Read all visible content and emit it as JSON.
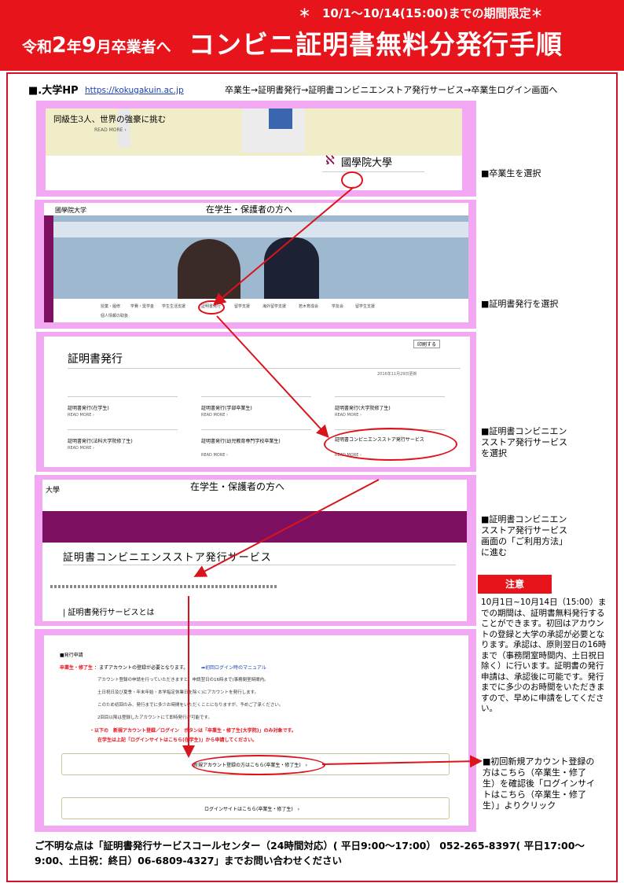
{
  "banner": {
    "subtitle": "＊　10/1～10/14(15:00)までの期間限定＊",
    "lead_a": "令和",
    "lead_b": "2",
    "lead_c": "年",
    "lead_d": "9",
    "lead_e": "月卒業者へ",
    "title": "コンビニ証明書無料分発行手順"
  },
  "header": {
    "hp_label": "■.大学HP",
    "url": "https://kokugakuin.ac.jp",
    "nav_path": "卒業生→証明書発行→証明書コンビニエンストア発行サービス→卒業生ログイン画面へ"
  },
  "steps": {
    "s1": {
      "banner_text": "同級生3人、世界の強豪に挑む",
      "read_more": "READ  MORE  ›",
      "university": "國學院大學",
      "note": "■卒業生を選択"
    },
    "s2": {
      "logo": "國學院大学",
      "heading": "在学生・保護者の方へ",
      "note": "■証明書発行を選択",
      "menu": [
        "授業・履修",
        "学費・奨学金",
        "学生生活支援",
        "証明書発行",
        "留学支援",
        "海外留学支援",
        "若木育成会",
        "学友会",
        "留学生支援",
        "個人情報の取扱"
      ]
    },
    "s3": {
      "print": "印刷する",
      "heading": "証明書発行",
      "date": "2016年11月29日更新",
      "read_more": "READ  MORE  ›",
      "items": [
        "証明書発行(在学生)",
        "証明書発行(学部卒業生)",
        "証明書発行(大学院修了生)",
        "証明書発行(法科大学院修了生)",
        "証明書発行(幼児教育専門学校卒業生)",
        "証明書コンビニエンスストア発行サービス"
      ],
      "note": "■証明書コンビニエン\nスストア発行サービス\nを選択"
    },
    "s4": {
      "logo": "大學",
      "heading": "在学生・保護者の方へ",
      "service_title": "証明書コンビニエンスストア発行サービス",
      "section": "| 証明書発行サービスとは",
      "note": "■証明書コンビニエン\nスストア発行サービス\n画面の「ご利用方法」\nに進む"
    },
    "s5": {
      "label": "■発行申請",
      "role": "卒業生・修了生",
      "intro": "：まずアカウントの登録が必要となります。",
      "manual_link": "➡初回ログイン時のマニュアル",
      "lines": [
        "アカウント登録の申請を行っていただきますと、申請翌日の16時まで(事務閉室時間内。",
        "土日祝日及び夏季・年末年始・本学指定休業日を除く)にアカウントを発行します。",
        "このため初回のみ、発行までに多少お時間をいただくことになりますが、予めご了承ください。",
        "2回目以降は登録したアカウントにて即時発行が可能です。"
      ],
      "red1": "・以下の　新規アカウント登録／ログイン　ボタンは「卒業生・修了生(大学院)」のみ対象です。",
      "red2": "在学生は上記「ログインサイトはこちら(在学生)」から申請してください。",
      "btn_new": "新規アカウント登録の方はこちら(卒業生・修了生)　›",
      "btn_login": "ログインサイトはこちら(卒業生・修了生)　›",
      "note": "■初回新規アカウント登録の\n方はこちら（卒業生・修了\n生）を確認後「ログインサイ\nトはこちら（卒業生・修了\n生）」よりクリック"
    }
  },
  "caution": {
    "label": "注意",
    "text": "10月1日~10月14日（15:00）までの期間は、証明書無料発行することができます。初回はアカウントの登録と大学の承認が必要となります。承認は、原則翌日の16時まで（事務閉室時間内、土日祝日除く）に行います。証明書の発行申請は、承認後に可能です。発行までに多少のお時間をいただきますので、早めに申請をしてください。"
  },
  "footer": {
    "text": "ご不明な点は「証明書発行サービスコールセンター（24時間対応）( 平日9:00～17:00） 052-265-8397( 平日17:00～9:00、土日祝：終日）06-6809-4327」までお問い合わせください"
  },
  "colors": {
    "banner_red": "#e8141c",
    "panel_pink": "#f2a8f2",
    "arrow_red": "#d8141c",
    "menu_purple": "#7d1060"
  }
}
